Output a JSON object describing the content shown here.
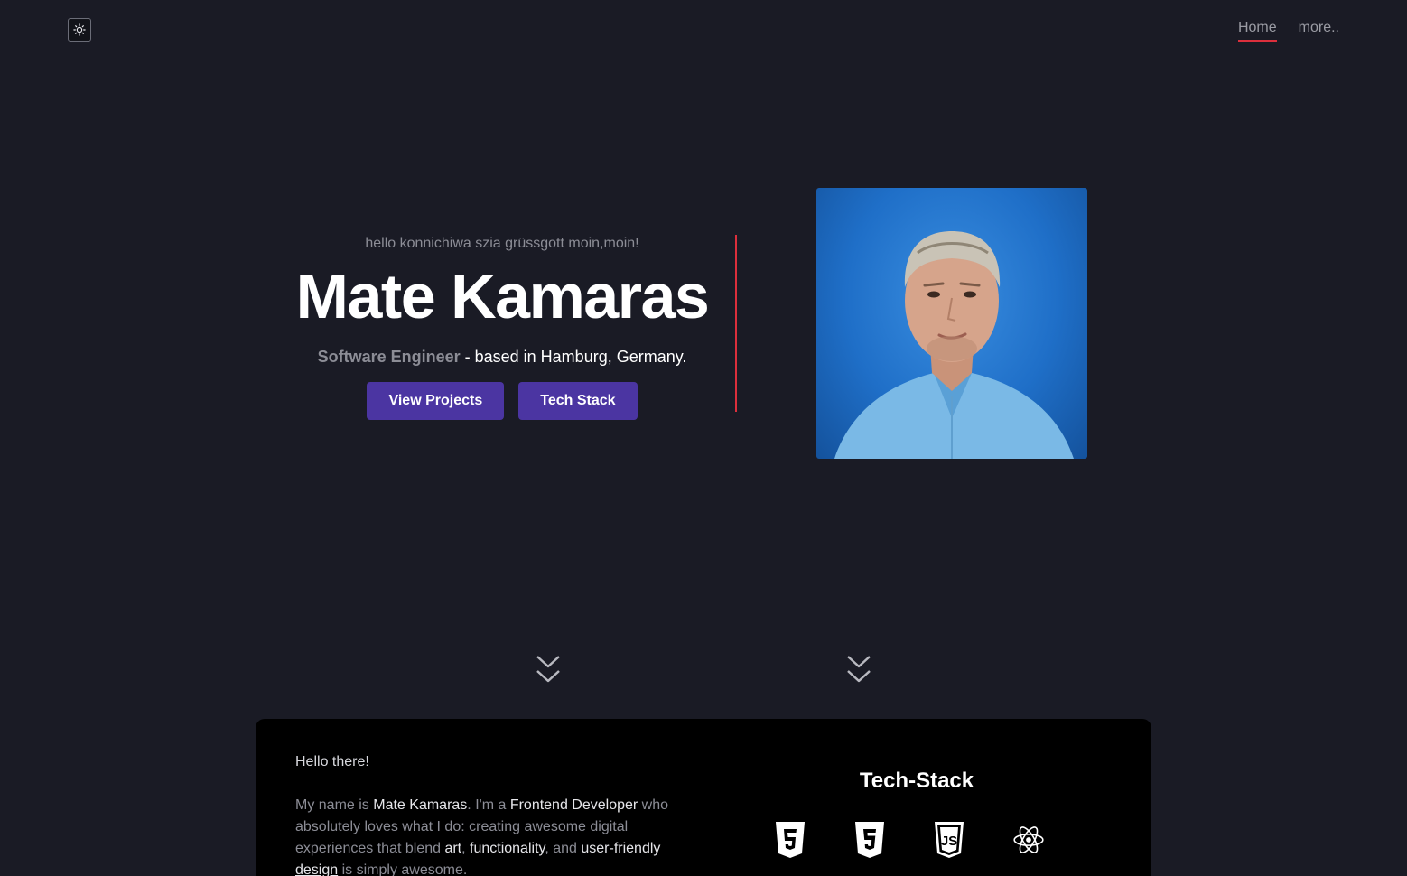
{
  "header": {
    "theme_toggle_icon": "sun-icon",
    "nav": [
      {
        "label": "Home",
        "active": true
      },
      {
        "label": "more..",
        "active": false
      }
    ],
    "accent_color": "#dc2f3c"
  },
  "hero": {
    "greeting": "hello konnichiwa szia grüssgott moin,moin!",
    "name": "Mate Kamaras",
    "role": "Software Engineer",
    "location": " - based in Hamburg, Germany.",
    "buttons": {
      "view_projects": "View Projects",
      "tech_stack": "Tech Stack"
    },
    "button_color": "#4b35a2",
    "portrait_icon": "portrait-photo"
  },
  "scroll_icons": [
    "chevron-double-down-icon",
    "chevron-double-down-icon"
  ],
  "about": {
    "heading": "Hello there!",
    "p_intro": "My name is ",
    "p_name": "Mate Kamaras",
    "p_mid1": ". I'm a ",
    "p_role": "Frontend Developer",
    "p_mid2": " who absolutely loves what I do: creating awesome digital experiences that blend ",
    "p_art": "art",
    "p_comma": ", ",
    "p_functionality": "functionality",
    "p_and": ", and ",
    "p_ufd1": "user-friendly",
    "p_ufd2": "design",
    "p_end": " is simply awesome."
  },
  "tech_stack": {
    "title": "Tech-Stack",
    "icons": [
      "html5-icon",
      "css3-icon",
      "javascript-icon",
      "react-icon"
    ]
  }
}
